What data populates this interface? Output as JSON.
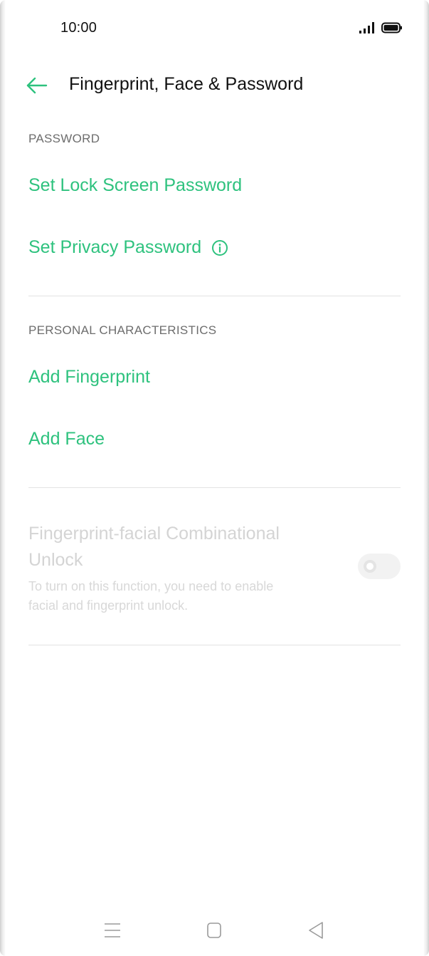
{
  "status_bar": {
    "time": "10:00",
    "icons": [
      "signal-icon",
      "battery-icon"
    ]
  },
  "header": {
    "back_icon": "arrow-left-icon",
    "title": "Fingerprint, Face & Password"
  },
  "sections": {
    "password": {
      "header": "PASSWORD",
      "items": [
        {
          "label": "Set Lock Screen Password"
        },
        {
          "label": "Set Privacy Password",
          "icon": "info-icon"
        }
      ]
    },
    "personal": {
      "header": "PERSONAL CHARACTERISTICS",
      "items": [
        {
          "label": "Add Fingerprint"
        },
        {
          "label": "Add Face"
        }
      ]
    },
    "combination": {
      "title_line1": "Fingerprint-facial Combinational",
      "title_line2": "Unlock",
      "desc_line1": "To turn on this function, you need to enable",
      "desc_line2": "facial and fingerprint unlock.",
      "toggle_enabled": false,
      "toggle_disabled_state": true
    }
  },
  "nav_bar": {
    "icons": [
      "menu-icon",
      "home-icon",
      "back-triangle-icon"
    ]
  },
  "colors": {
    "accent": "#2ec27e",
    "text_primary": "#111111",
    "section_header": "#6d6d6d",
    "disabled_text": "#d4d4d4",
    "divider": "#e3e3e3"
  }
}
